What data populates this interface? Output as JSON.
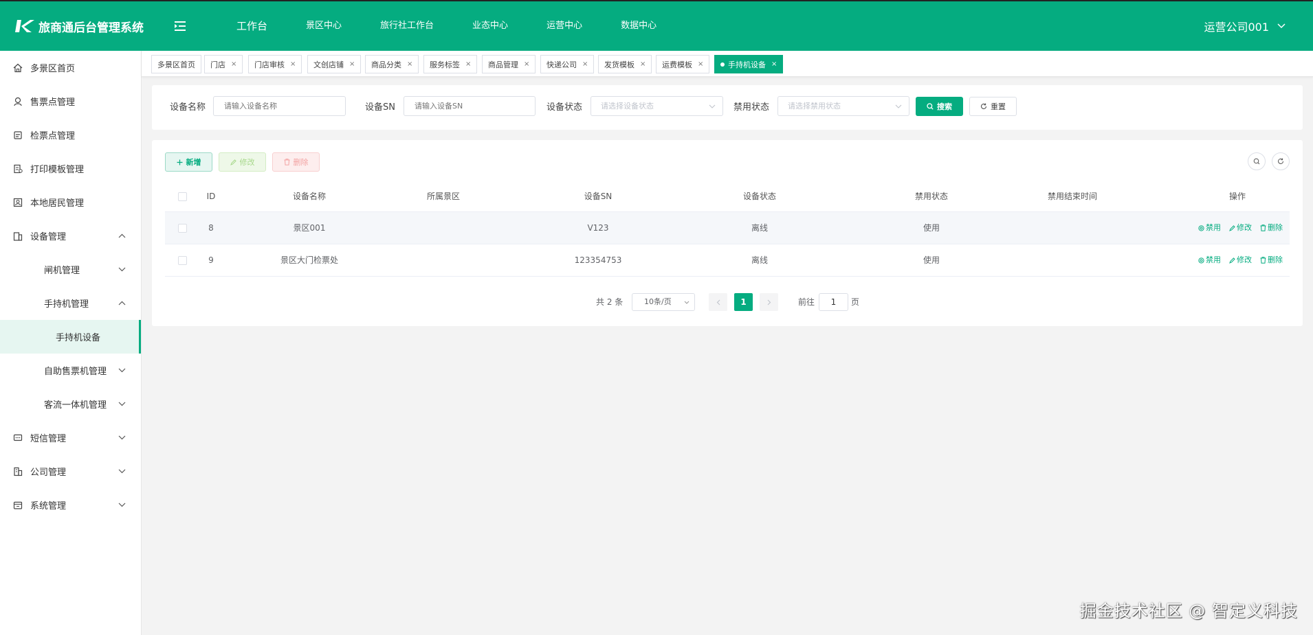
{
  "app": {
    "title": "旅商通后台管理系统",
    "brand_color": "#05ac80"
  },
  "topnav": [
    {
      "label": "工作台"
    },
    {
      "label": "景区中心"
    },
    {
      "label": "旅行社工作台"
    },
    {
      "label": "业态中心"
    },
    {
      "label": "运营中心"
    },
    {
      "label": "数据中心"
    }
  ],
  "user": {
    "name": "运营公司001"
  },
  "sidebar": [
    {
      "label": "多景区首页",
      "icon": "home-icon"
    },
    {
      "label": "售票点管理",
      "icon": "ticket-sale-icon"
    },
    {
      "label": "检票点管理",
      "icon": "ticket-check-icon"
    },
    {
      "label": "打印模板管理",
      "icon": "print-template-icon"
    },
    {
      "label": "本地居民管理",
      "icon": "resident-icon"
    },
    {
      "label": "设备管理",
      "icon": "device-icon",
      "expanded": true
    },
    {
      "label": "闸机管理"
    },
    {
      "label": "手持机管理",
      "expanded": true
    },
    {
      "label": "手持机设备",
      "active": true
    },
    {
      "label": "自助售票机管理"
    },
    {
      "label": "客流一体机管理"
    },
    {
      "label": "短信管理",
      "icon": "sms-icon"
    },
    {
      "label": "公司管理",
      "icon": "company-icon"
    },
    {
      "label": "系统管理",
      "icon": "system-icon"
    }
  ],
  "tabs": [
    {
      "label": "多景区首页",
      "closable": false
    },
    {
      "label": "门店",
      "closable": true
    },
    {
      "label": "门店审核",
      "closable": true
    },
    {
      "label": "文创店铺",
      "closable": true
    },
    {
      "label": "商品分类",
      "closable": true
    },
    {
      "label": "服务标签",
      "closable": true
    },
    {
      "label": "商品管理",
      "closable": true
    },
    {
      "label": "快递公司",
      "closable": true
    },
    {
      "label": "发货模板",
      "closable": true
    },
    {
      "label": "运费模板",
      "closable": true
    },
    {
      "label": "手持机设备",
      "closable": true,
      "active": true
    }
  ],
  "tab_close": "×",
  "search": {
    "device_name_label": "设备名称",
    "device_name_placeholder": "请输入设备名称",
    "device_sn_label": "设备SN",
    "device_sn_placeholder": "请输入设备SN",
    "device_status_label": "设备状态",
    "device_status_placeholder": "请选择设备状态",
    "disable_status_label": "禁用状态",
    "disable_status_placeholder": "请选择禁用状态",
    "search_button": "搜索",
    "reset_button": "重置"
  },
  "toolbar": {
    "add": "新增",
    "edit": "修改",
    "delete": "删除"
  },
  "table": {
    "columns": [
      "ID",
      "设备名称",
      "所属景区",
      "设备SN",
      "设备状态",
      "禁用状态",
      "禁用结束时间",
      "操作"
    ],
    "rows": [
      {
        "id": "8",
        "name": "景区001",
        "scenic": "",
        "sn": "V123",
        "status": "离线",
        "disable": "使用",
        "end": ""
      },
      {
        "id": "9",
        "name": "景区大门检票处",
        "scenic": "",
        "sn": "123354753",
        "status": "离线",
        "disable": "使用",
        "end": ""
      }
    ],
    "actions": {
      "disable": "禁用",
      "edit": "修改",
      "delete": "删除"
    }
  },
  "pagination": {
    "total_text": "共 2 条",
    "page_size": "10条/页",
    "current_page": "1",
    "goto_label": "前往",
    "goto_value": "1",
    "page_suffix": "页"
  },
  "watermark": "掘金技术社区 @ 智定义科技"
}
